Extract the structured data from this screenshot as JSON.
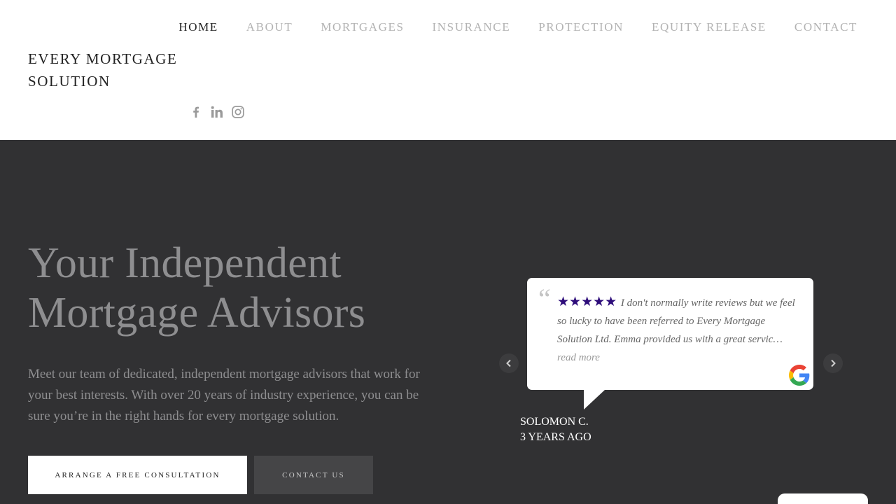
{
  "nav": {
    "items": [
      "HOME",
      "ABOUT",
      "MORTGAGES",
      "INSURANCE",
      "PROTECTION",
      "EQUITY RELEASE",
      "CONTACT"
    ],
    "active": "HOME"
  },
  "logo": {
    "alt_text": "EVERY MORTGAGE SOLUTION"
  },
  "social": {
    "icons": [
      "facebook-icon",
      "linkedin-icon",
      "instagram-icon"
    ],
    "color": "#9a9a9a"
  },
  "hero": {
    "background": "#313133",
    "title": "Your Independent Mortgage Advisors",
    "description": "Meet our team of dedicated, independent mortgage advisors that work for your best interests. With over 20 years of industry experience, you can be sure you’re in the right hands for every mortgage solution.",
    "primary_button": "ARRANGE A FREE CONSULTATION",
    "secondary_button": "CONTACT US"
  },
  "review": {
    "stars": "★★★★★",
    "rating": 5,
    "star_color": "#2d0c7a",
    "text": "I don't normally write reviews but we feel so lucky to have been referred to Every Mortgage Solution Ltd. Emma provided us with a great servic…",
    "read_more": "read more",
    "author": "SOLOMON C.",
    "time": "3 YEARS AGO"
  }
}
